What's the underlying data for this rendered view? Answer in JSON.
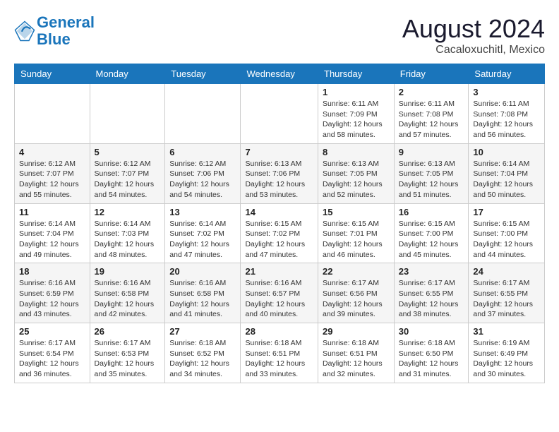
{
  "header": {
    "logo_line1": "General",
    "logo_line2": "Blue",
    "month_year": "August 2024",
    "location": "Cacaloxuchitl, Mexico"
  },
  "weekdays": [
    "Sunday",
    "Monday",
    "Tuesday",
    "Wednesday",
    "Thursday",
    "Friday",
    "Saturday"
  ],
  "weeks": [
    [
      {
        "day": "",
        "sunrise": "",
        "sunset": "",
        "daylight": ""
      },
      {
        "day": "",
        "sunrise": "",
        "sunset": "",
        "daylight": ""
      },
      {
        "day": "",
        "sunrise": "",
        "sunset": "",
        "daylight": ""
      },
      {
        "day": "",
        "sunrise": "",
        "sunset": "",
        "daylight": ""
      },
      {
        "day": "1",
        "sunrise": "Sunrise: 6:11 AM",
        "sunset": "Sunset: 7:09 PM",
        "daylight": "Daylight: 12 hours and 58 minutes."
      },
      {
        "day": "2",
        "sunrise": "Sunrise: 6:11 AM",
        "sunset": "Sunset: 7:08 PM",
        "daylight": "Daylight: 12 hours and 57 minutes."
      },
      {
        "day": "3",
        "sunrise": "Sunrise: 6:11 AM",
        "sunset": "Sunset: 7:08 PM",
        "daylight": "Daylight: 12 hours and 56 minutes."
      }
    ],
    [
      {
        "day": "4",
        "sunrise": "Sunrise: 6:12 AM",
        "sunset": "Sunset: 7:07 PM",
        "daylight": "Daylight: 12 hours and 55 minutes."
      },
      {
        "day": "5",
        "sunrise": "Sunrise: 6:12 AM",
        "sunset": "Sunset: 7:07 PM",
        "daylight": "Daylight: 12 hours and 54 minutes."
      },
      {
        "day": "6",
        "sunrise": "Sunrise: 6:12 AM",
        "sunset": "Sunset: 7:06 PM",
        "daylight": "Daylight: 12 hours and 54 minutes."
      },
      {
        "day": "7",
        "sunrise": "Sunrise: 6:13 AM",
        "sunset": "Sunset: 7:06 PM",
        "daylight": "Daylight: 12 hours and 53 minutes."
      },
      {
        "day": "8",
        "sunrise": "Sunrise: 6:13 AM",
        "sunset": "Sunset: 7:05 PM",
        "daylight": "Daylight: 12 hours and 52 minutes."
      },
      {
        "day": "9",
        "sunrise": "Sunrise: 6:13 AM",
        "sunset": "Sunset: 7:05 PM",
        "daylight": "Daylight: 12 hours and 51 minutes."
      },
      {
        "day": "10",
        "sunrise": "Sunrise: 6:14 AM",
        "sunset": "Sunset: 7:04 PM",
        "daylight": "Daylight: 12 hours and 50 minutes."
      }
    ],
    [
      {
        "day": "11",
        "sunrise": "Sunrise: 6:14 AM",
        "sunset": "Sunset: 7:04 PM",
        "daylight": "Daylight: 12 hours and 49 minutes."
      },
      {
        "day": "12",
        "sunrise": "Sunrise: 6:14 AM",
        "sunset": "Sunset: 7:03 PM",
        "daylight": "Daylight: 12 hours and 48 minutes."
      },
      {
        "day": "13",
        "sunrise": "Sunrise: 6:14 AM",
        "sunset": "Sunset: 7:02 PM",
        "daylight": "Daylight: 12 hours and 47 minutes."
      },
      {
        "day": "14",
        "sunrise": "Sunrise: 6:15 AM",
        "sunset": "Sunset: 7:02 PM",
        "daylight": "Daylight: 12 hours and 47 minutes."
      },
      {
        "day": "15",
        "sunrise": "Sunrise: 6:15 AM",
        "sunset": "Sunset: 7:01 PM",
        "daylight": "Daylight: 12 hours and 46 minutes."
      },
      {
        "day": "16",
        "sunrise": "Sunrise: 6:15 AM",
        "sunset": "Sunset: 7:00 PM",
        "daylight": "Daylight: 12 hours and 45 minutes."
      },
      {
        "day": "17",
        "sunrise": "Sunrise: 6:15 AM",
        "sunset": "Sunset: 7:00 PM",
        "daylight": "Daylight: 12 hours and 44 minutes."
      }
    ],
    [
      {
        "day": "18",
        "sunrise": "Sunrise: 6:16 AM",
        "sunset": "Sunset: 6:59 PM",
        "daylight": "Daylight: 12 hours and 43 minutes."
      },
      {
        "day": "19",
        "sunrise": "Sunrise: 6:16 AM",
        "sunset": "Sunset: 6:58 PM",
        "daylight": "Daylight: 12 hours and 42 minutes."
      },
      {
        "day": "20",
        "sunrise": "Sunrise: 6:16 AM",
        "sunset": "Sunset: 6:58 PM",
        "daylight": "Daylight: 12 hours and 41 minutes."
      },
      {
        "day": "21",
        "sunrise": "Sunrise: 6:16 AM",
        "sunset": "Sunset: 6:57 PM",
        "daylight": "Daylight: 12 hours and 40 minutes."
      },
      {
        "day": "22",
        "sunrise": "Sunrise: 6:17 AM",
        "sunset": "Sunset: 6:56 PM",
        "daylight": "Daylight: 12 hours and 39 minutes."
      },
      {
        "day": "23",
        "sunrise": "Sunrise: 6:17 AM",
        "sunset": "Sunset: 6:55 PM",
        "daylight": "Daylight: 12 hours and 38 minutes."
      },
      {
        "day": "24",
        "sunrise": "Sunrise: 6:17 AM",
        "sunset": "Sunset: 6:55 PM",
        "daylight": "Daylight: 12 hours and 37 minutes."
      }
    ],
    [
      {
        "day": "25",
        "sunrise": "Sunrise: 6:17 AM",
        "sunset": "Sunset: 6:54 PM",
        "daylight": "Daylight: 12 hours and 36 minutes."
      },
      {
        "day": "26",
        "sunrise": "Sunrise: 6:17 AM",
        "sunset": "Sunset: 6:53 PM",
        "daylight": "Daylight: 12 hours and 35 minutes."
      },
      {
        "day": "27",
        "sunrise": "Sunrise: 6:18 AM",
        "sunset": "Sunset: 6:52 PM",
        "daylight": "Daylight: 12 hours and 34 minutes."
      },
      {
        "day": "28",
        "sunrise": "Sunrise: 6:18 AM",
        "sunset": "Sunset: 6:51 PM",
        "daylight": "Daylight: 12 hours and 33 minutes."
      },
      {
        "day": "29",
        "sunrise": "Sunrise: 6:18 AM",
        "sunset": "Sunset: 6:51 PM",
        "daylight": "Daylight: 12 hours and 32 minutes."
      },
      {
        "day": "30",
        "sunrise": "Sunrise: 6:18 AM",
        "sunset": "Sunset: 6:50 PM",
        "daylight": "Daylight: 12 hours and 31 minutes."
      },
      {
        "day": "31",
        "sunrise": "Sunrise: 6:19 AM",
        "sunset": "Sunset: 6:49 PM",
        "daylight": "Daylight: 12 hours and 30 minutes."
      }
    ]
  ]
}
